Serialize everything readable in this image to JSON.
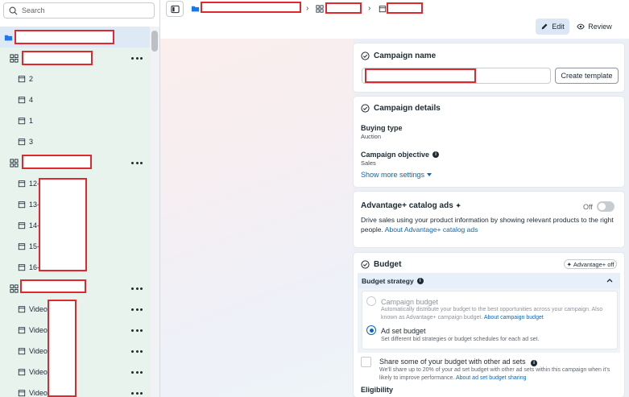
{
  "sidebar": {
    "search_placeholder": "Search",
    "items": [
      {
        "label": ""
      },
      {
        "label": ""
      },
      {
        "label": "2"
      },
      {
        "label": "4"
      },
      {
        "label": "1"
      },
      {
        "label": "3"
      },
      {
        "label": ""
      },
      {
        "label": "12-"
      },
      {
        "label": "13-"
      },
      {
        "label": "14-"
      },
      {
        "label": "15-"
      },
      {
        "label": "16-"
      },
      {
        "label": ""
      },
      {
        "label": "Video"
      },
      {
        "label": "Video"
      },
      {
        "label": "Video"
      },
      {
        "label": "Video"
      },
      {
        "label": "Video"
      }
    ]
  },
  "toolbar": {
    "edit_label": "Edit",
    "review_label": "Review"
  },
  "campaign_name": {
    "title": "Campaign name",
    "input_value": "",
    "create_template_label": "Create template"
  },
  "campaign_details": {
    "title": "Campaign details",
    "buying_type_label": "Buying type",
    "buying_type_value": "Auction",
    "objective_label": "Campaign objective",
    "objective_value": "Sales",
    "show_more": "Show more settings"
  },
  "catalog_ads": {
    "title": "Advantage+ catalog ads",
    "sparkle": "✦",
    "toggle_state": "Off",
    "description": "Drive sales using your product information by showing relevant products to the right people.",
    "link": "About Advantage+ catalog ads"
  },
  "budget": {
    "title": "Budget",
    "badge": "Advantage+ off",
    "strategy_label": "Budget strategy",
    "options": [
      {
        "title": "Campaign budget",
        "description": "Automatically distribute your budget to the best opportunities across your campaign. Also known as Advantage+ campaign budget.",
        "link": "About campaign budget",
        "selected": false,
        "disabled": true
      },
      {
        "title": "Ad set budget",
        "description": "Set different bid strategies or budget schedules for each ad set.",
        "link": "",
        "selected": true,
        "disabled": false
      }
    ],
    "share_label": "Share some of your budget with other ad sets",
    "share_description": "We'll share up to 20% of your ad set budget with other ad sets within this campaign when it's likely to improve performance.",
    "share_link": "About ad set budget sharing",
    "eligibility_label": "Eligibility"
  },
  "colors": {
    "accent": "#0a66c2",
    "redaction": "#e0282e",
    "tree_background": "#e8f3ee"
  }
}
